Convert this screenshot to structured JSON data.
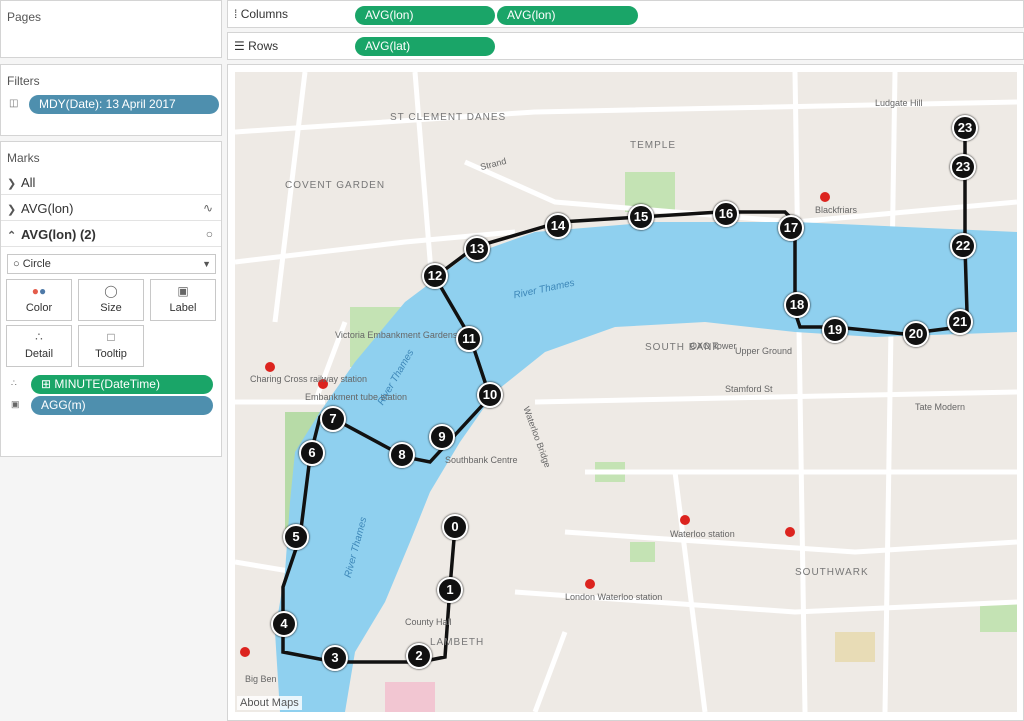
{
  "pages": {
    "title": "Pages"
  },
  "filters": {
    "title": "Filters",
    "items": [
      {
        "label": "MDY(Date): 13 April 2017"
      }
    ]
  },
  "marks": {
    "title": "Marks",
    "layers": [
      {
        "label": "All"
      },
      {
        "label": "AVG(lon)"
      },
      {
        "label": "AVG(lon) (2)"
      }
    ],
    "mark_type": "Circle",
    "buttons": [
      {
        "label": "Color"
      },
      {
        "label": "Size"
      },
      {
        "label": "Label"
      },
      {
        "label": "Detail"
      },
      {
        "label": "Tooltip"
      }
    ],
    "fields": [
      {
        "label": "MINUTE(DateTime)"
      },
      {
        "label": "AGG(m)"
      }
    ]
  },
  "shelves": {
    "columns_label": "Columns",
    "columns": [
      {
        "label": "AVG(lon)"
      },
      {
        "label": "AVG(lon)"
      }
    ],
    "rows_label": "Rows",
    "rows": [
      {
        "label": "AVG(lat)"
      }
    ]
  },
  "map": {
    "attribution": "About Maps",
    "labels": [
      {
        "text": "ST CLEMENT DANES"
      },
      {
        "text": "TEMPLE"
      },
      {
        "text": "COVENT GARDEN"
      },
      {
        "text": "SOUTH BANK"
      },
      {
        "text": "SOUTHWARK"
      },
      {
        "text": "LAMBETH"
      },
      {
        "text": "River Thames"
      },
      {
        "text": "River Thames"
      },
      {
        "text": "River Thames"
      },
      {
        "text": "Waterloo Bridge"
      },
      {
        "text": "Victoria Embankment Gardens"
      },
      {
        "text": "Southbank Centre"
      },
      {
        "text": "Waterloo station"
      },
      {
        "text": "London Waterloo station"
      },
      {
        "text": "Blackfriars"
      },
      {
        "text": "Strand"
      },
      {
        "text": "Stamford St"
      },
      {
        "text": "Upper Ground"
      },
      {
        "text": "Embankment tube station"
      },
      {
        "text": "Charing Cross railway station"
      },
      {
        "text": "Big Ben"
      },
      {
        "text": "County Hall"
      },
      {
        "text": "OXO Tower"
      },
      {
        "text": "Tate Modern"
      },
      {
        "text": "Ludgate Hill"
      }
    ],
    "route_markers": [
      "0",
      "1",
      "2",
      "3",
      "4",
      "5",
      "6",
      "7",
      "8",
      "9",
      "10",
      "11",
      "12",
      "13",
      "14",
      "15",
      "16",
      "17",
      "18",
      "19",
      "20",
      "21",
      "22",
      "23",
      "23"
    ]
  },
  "colors": {
    "pill_blue": "#4e8fae",
    "pill_green": "#1aa568",
    "water": "#8fd0ef",
    "marker": "#111111",
    "route": "#111111"
  }
}
